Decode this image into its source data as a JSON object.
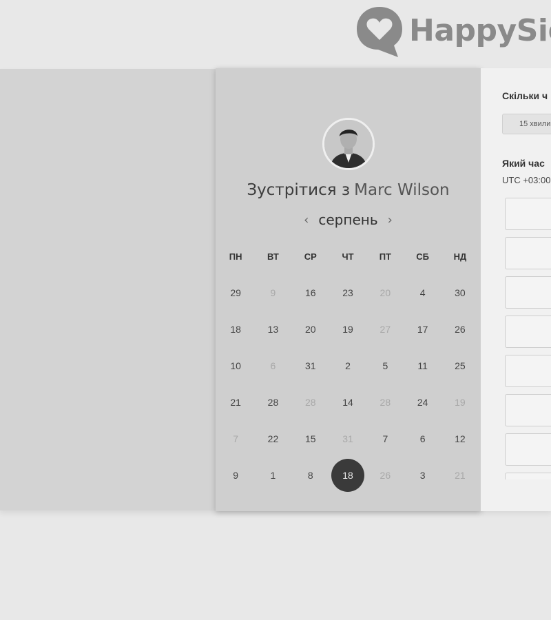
{
  "logo": {
    "text": "HappySig",
    "icon": "heart-chat-bubble-icon",
    "color": "#8a8a8a"
  },
  "calendar": {
    "avatar": "host-avatar",
    "meet_prefix": "Зустрітися з",
    "host_name": "Marc Wilson",
    "month": "серпень",
    "prev_icon": "‹",
    "next_icon": "›",
    "weekdays": [
      "ПН",
      "ВТ",
      "СР",
      "ЧТ",
      "ПТ",
      "СБ",
      "НД"
    ],
    "days": [
      {
        "label": "29",
        "muted": false
      },
      {
        "label": "9",
        "muted": true
      },
      {
        "label": "16",
        "muted": false
      },
      {
        "label": "23",
        "muted": false
      },
      {
        "label": "20",
        "muted": true
      },
      {
        "label": "4",
        "muted": false
      },
      {
        "label": "30",
        "muted": false
      },
      {
        "label": "18",
        "muted": false
      },
      {
        "label": "13",
        "muted": false
      },
      {
        "label": "20",
        "muted": false
      },
      {
        "label": "19",
        "muted": false
      },
      {
        "label": "27",
        "muted": true
      },
      {
        "label": "17",
        "muted": false
      },
      {
        "label": "26",
        "muted": false
      },
      {
        "label": "10",
        "muted": false
      },
      {
        "label": "6",
        "muted": true
      },
      {
        "label": "31",
        "muted": false
      },
      {
        "label": "2",
        "muted": false
      },
      {
        "label": "5",
        "muted": false
      },
      {
        "label": "11",
        "muted": false
      },
      {
        "label": "25",
        "muted": false
      },
      {
        "label": "21",
        "muted": false
      },
      {
        "label": "28",
        "muted": false
      },
      {
        "label": "28",
        "muted": true
      },
      {
        "label": "14",
        "muted": false
      },
      {
        "label": "28",
        "muted": true
      },
      {
        "label": "24",
        "muted": false
      },
      {
        "label": "19",
        "muted": true
      },
      {
        "label": "7",
        "muted": true
      },
      {
        "label": "22",
        "muted": false
      },
      {
        "label": "15",
        "muted": false
      },
      {
        "label": "31",
        "muted": true
      },
      {
        "label": "7",
        "muted": false
      },
      {
        "label": "6",
        "muted": false
      },
      {
        "label": "12",
        "muted": false
      },
      {
        "label": "9",
        "muted": false
      },
      {
        "label": "1",
        "muted": false
      },
      {
        "label": "8",
        "muted": false
      },
      {
        "label": "18",
        "muted": false,
        "selected": true
      },
      {
        "label": "26",
        "muted": true
      },
      {
        "label": "3",
        "muted": false
      },
      {
        "label": "21",
        "muted": true
      }
    ],
    "selected_color": "#3a3a3a"
  },
  "panel": {
    "duration_question": "Скільки ч",
    "duration_option": "15 хвили",
    "time_question": "Який час",
    "timezone": "UTC +03:00",
    "slot_count": 8
  }
}
